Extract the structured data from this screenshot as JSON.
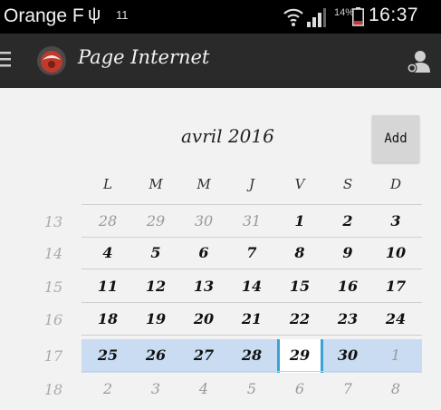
{
  "statusbar": {
    "carrier": "Orange F",
    "usb_icon": "ψ",
    "notification": "11",
    "battery_percent": "14%",
    "time": "16:37",
    "icons": [
      "usb-icon",
      "wifi-icon",
      "signal-icon",
      "battery-icon"
    ]
  },
  "actionbar": {
    "title": "Page Internet",
    "icons": [
      "menu-icon",
      "app-icon",
      "account-icon"
    ]
  },
  "calendar": {
    "month_label": "avril 2016",
    "add_label": "Add",
    "day_headers": [
      "L",
      "M",
      "M",
      "J",
      "V",
      "S",
      "D"
    ],
    "weeks": [
      {
        "week": "13",
        "days": [
          "28",
          "29",
          "30",
          "31",
          "1",
          "2",
          "3"
        ]
      },
      {
        "week": "14",
        "days": [
          "4",
          "5",
          "6",
          "7",
          "8",
          "9",
          "10"
        ]
      },
      {
        "week": "15",
        "days": [
          "11",
          "12",
          "13",
          "14",
          "15",
          "16",
          "17"
        ]
      },
      {
        "week": "16",
        "days": [
          "18",
          "19",
          "20",
          "21",
          "22",
          "23",
          "24"
        ]
      },
      {
        "week": "17",
        "days": [
          "25",
          "26",
          "27",
          "28",
          "29",
          "30",
          "1"
        ]
      },
      {
        "week": "18",
        "days": [
          "2",
          "3",
          "4",
          "5",
          "6",
          "7",
          "8"
        ]
      }
    ],
    "colors": {
      "selection": "#c9dcf2",
      "today_marker": "#3aa3d4"
    }
  }
}
